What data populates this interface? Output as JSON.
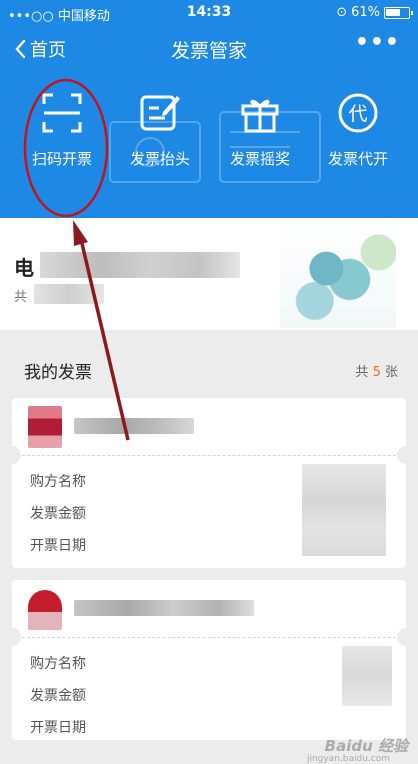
{
  "status_bar": {
    "carrier": "•••○○ 中国移动",
    "time": "14:33",
    "battery_text": "61%"
  },
  "nav": {
    "back_label": "首页",
    "title": "发票管家",
    "more_label": "•••"
  },
  "toolbar": {
    "items": [
      {
        "label": "扫码开票",
        "icon": "scan-icon"
      },
      {
        "label": "发票抬头",
        "icon": "edit-icon"
      },
      {
        "label": "发票摇奖",
        "icon": "gift-icon"
      },
      {
        "label": "发票代开",
        "icon": "proxy-icon",
        "glyph": "代"
      }
    ]
  },
  "summary_card": {
    "title_visible": "电",
    "sub_visible": "共"
  },
  "invoices_section": {
    "title": "我的发票",
    "count_prefix": "共",
    "count": "5",
    "count_suffix": "张"
  },
  "invoices": [
    {
      "fields": [
        {
          "label": "购方名称"
        },
        {
          "label": "发票金额"
        },
        {
          "label": "开票日期"
        }
      ]
    },
    {
      "fields": [
        {
          "label": "购方名称"
        },
        {
          "label": "发票金额"
        },
        {
          "label": "开票日期"
        }
      ]
    }
  ],
  "colors": {
    "primary": "#1e88e5",
    "accent": "#f26b1d",
    "annotation": "#c0141e"
  },
  "watermark": {
    "text": "Baidu 经验",
    "sub": "jingyan.baidu.com"
  }
}
